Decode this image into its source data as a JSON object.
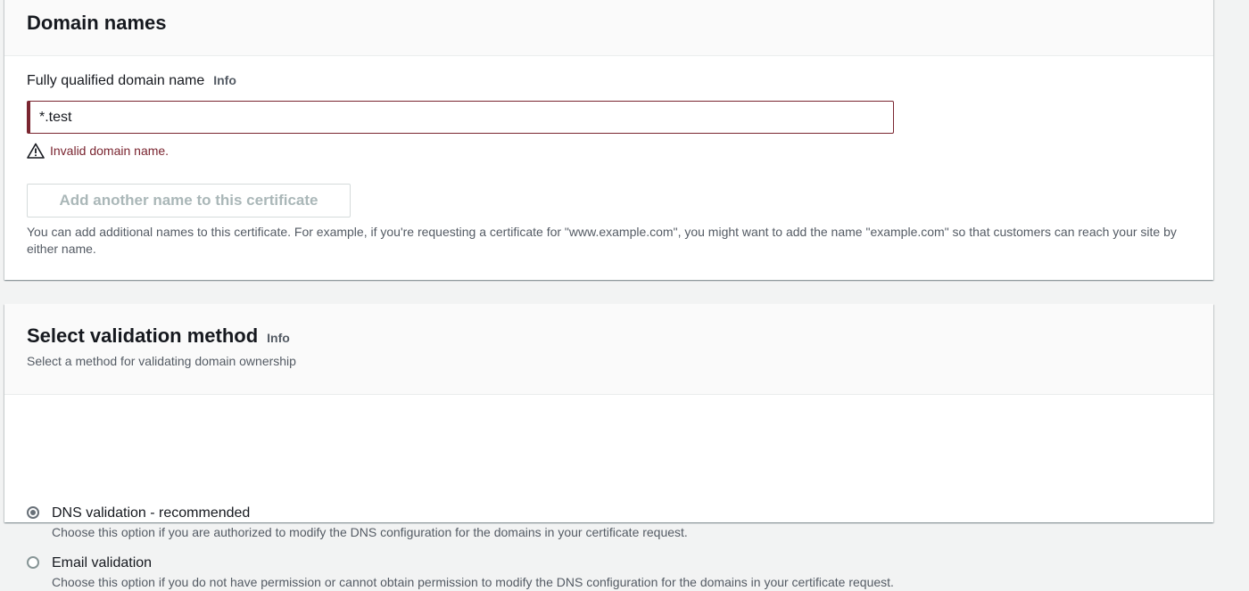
{
  "domain_panel": {
    "title": "Domain names",
    "field_label": "Fully qualified domain name",
    "info_label": "Info",
    "input_value": "*.test",
    "error_message": "Invalid domain name.",
    "add_button_label": "Add another name to this certificate",
    "help_text": "You can add additional names to this certificate. For example, if you're requesting a certificate for \"www.example.com\", you might want to add the name \"example.com\" so that customers can reach your site by either name."
  },
  "validation_panel": {
    "title": "Select validation method",
    "info_label": "Info",
    "description": "Select a method for validating domain ownership",
    "options": [
      {
        "label": "DNS validation - recommended",
        "description": "Choose this option if you are authorized to modify the DNS configuration for the domains in your certificate request.",
        "selected": true
      },
      {
        "label": "Email validation",
        "description": "Choose this option if you do not have permission or cannot obtain permission to modify the DNS configuration for the domains in your certificate request.",
        "selected": false
      }
    ]
  },
  "colors": {
    "error": "#7a2530",
    "page_background": "#f2f3f3",
    "disabled_text": "#aab7b8"
  },
  "icons": {
    "error": "warning-icon"
  }
}
